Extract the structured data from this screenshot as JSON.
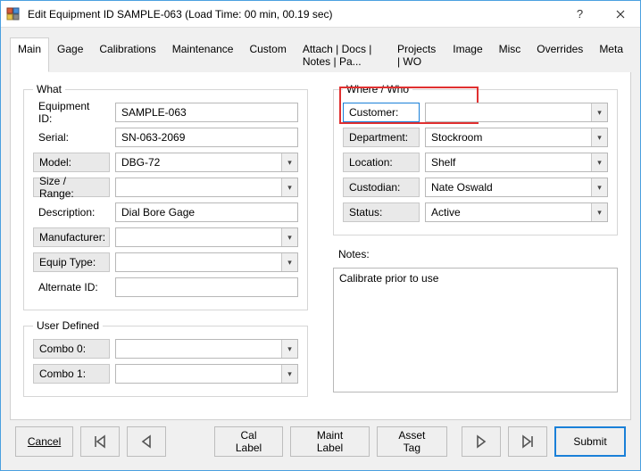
{
  "titlebar": {
    "title": "Edit Equipment ID SAMPLE-063 (Load Time: 00 min, 00.19 sec)"
  },
  "tabs": [
    "Main",
    "Gage",
    "Calibrations",
    "Maintenance",
    "Custom",
    "Attach | Docs | Notes | Pa...",
    "Projects | WO",
    "Image",
    "Misc",
    "Overrides",
    "Meta"
  ],
  "what": {
    "legend": "What",
    "equipment_id": {
      "label": "Equipment ID:",
      "value": "SAMPLE-063"
    },
    "serial": {
      "label": "Serial:",
      "value": "SN-063-2069"
    },
    "model": {
      "label": "Model:",
      "value": "DBG-72"
    },
    "size_range": {
      "label": "Size / Range:",
      "value": ""
    },
    "description": {
      "label": "Description:",
      "value": "Dial Bore Gage"
    },
    "manufacturer": {
      "label": "Manufacturer:",
      "value": ""
    },
    "equip_type": {
      "label": "Equip Type:",
      "value": ""
    },
    "alternate_id": {
      "label": "Alternate ID:",
      "value": ""
    }
  },
  "user_defined": {
    "legend": "User Defined",
    "combo0": {
      "label": "Combo 0:",
      "value": ""
    },
    "combo1": {
      "label": "Combo 1:",
      "value": ""
    }
  },
  "where": {
    "legend": "Where / Who",
    "customer": {
      "label": "Customer:",
      "value": ""
    },
    "department": {
      "label": "Department:",
      "value": "Stockroom"
    },
    "location": {
      "label": "Location:",
      "value": "Shelf"
    },
    "custodian": {
      "label": "Custodian:",
      "value": "Nate Oswald"
    },
    "status": {
      "label": "Status:",
      "value": "Active"
    }
  },
  "notes": {
    "label": "Notes:",
    "value": "Calibrate prior to use"
  },
  "footer": {
    "cancel": "Cancel",
    "cal_label": "Cal Label",
    "maint_label": "Maint Label",
    "asset_tag": "Asset Tag",
    "submit": "Submit"
  }
}
